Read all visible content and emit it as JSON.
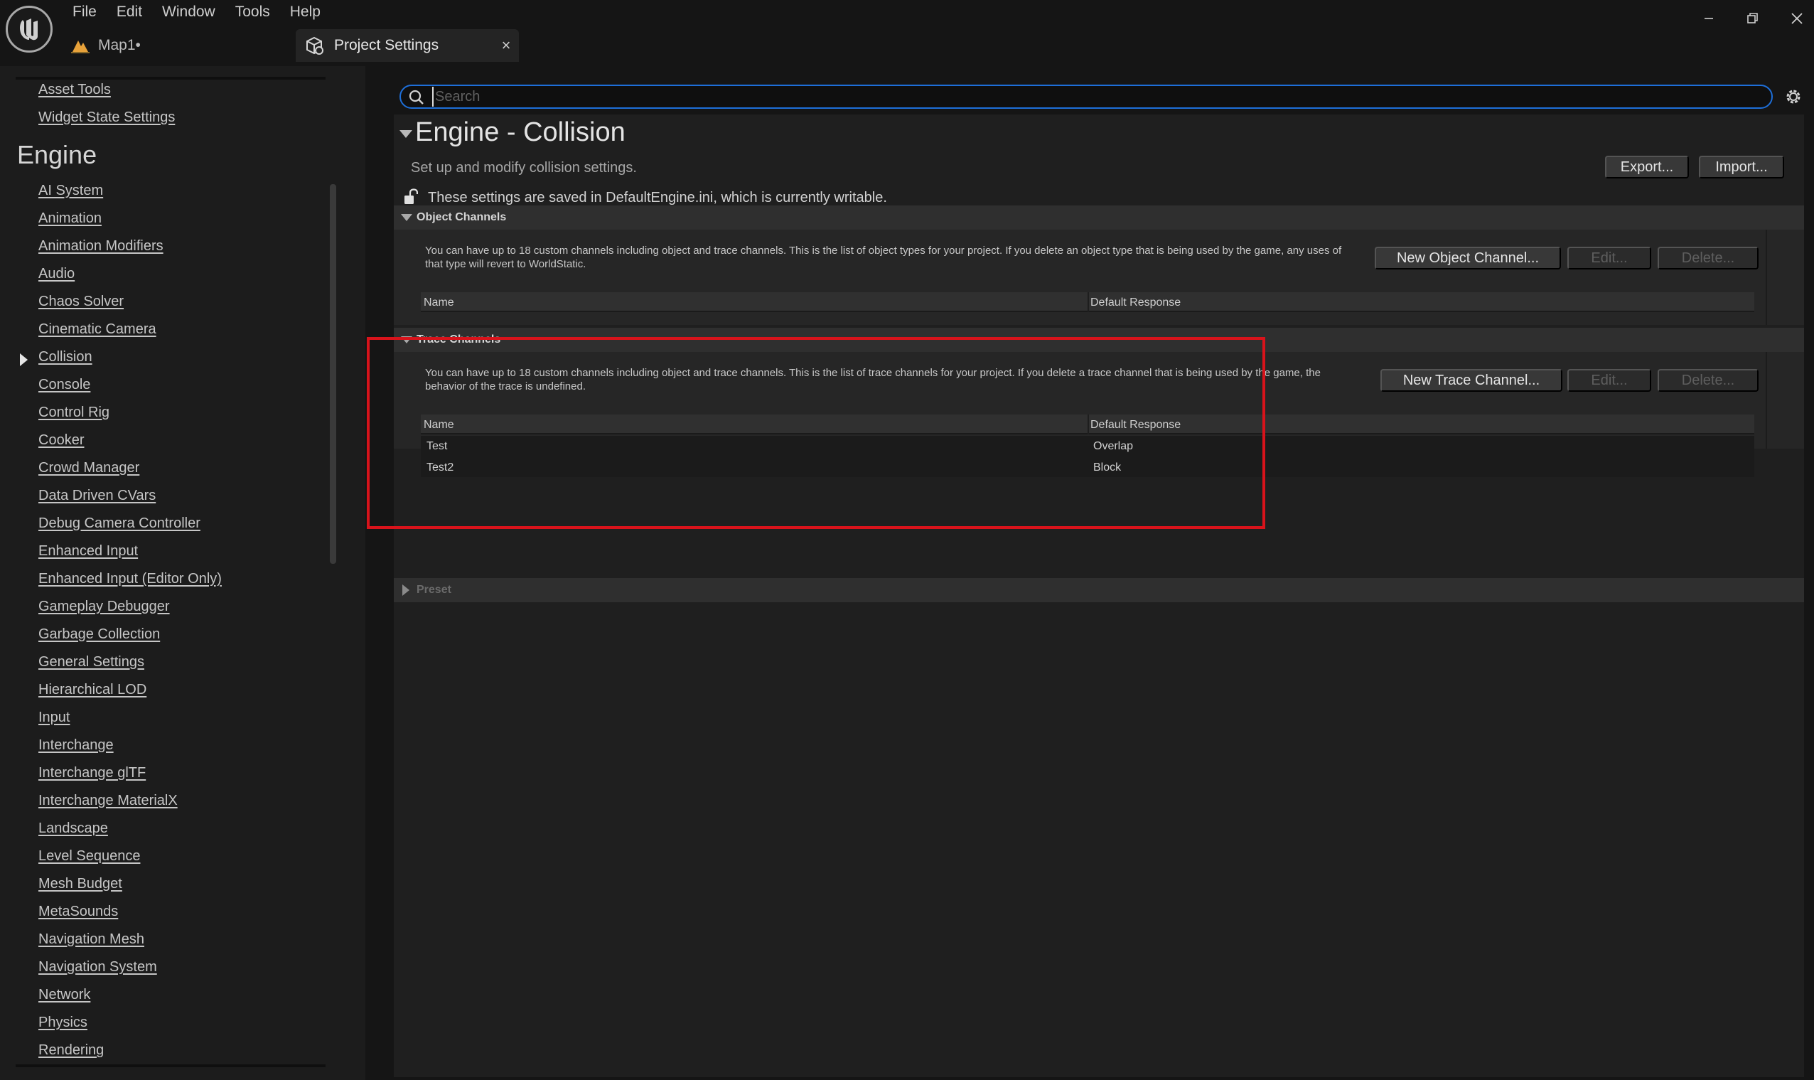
{
  "menu": [
    "File",
    "Edit",
    "Window",
    "Tools",
    "Help"
  ],
  "tabs": {
    "map": "Map1•",
    "settings": "Project Settings",
    "settings_close": "×"
  },
  "sidebar": {
    "top_items": [
      "Asset Tools",
      "Widget State Settings"
    ],
    "engine_heading": "Engine",
    "engine_items": [
      "AI System",
      "Animation",
      "Animation Modifiers",
      "Audio",
      "Chaos Solver",
      "Cinematic Camera",
      "Collision",
      "Console",
      "Control Rig",
      "Cooker",
      "Crowd Manager",
      "Data Driven CVars",
      "Debug Camera Controller",
      "Enhanced Input",
      "Enhanced Input (Editor Only)",
      "Gameplay Debugger",
      "Garbage Collection",
      "General Settings",
      "Hierarchical LOD",
      "Input",
      "Interchange",
      "Interchange glTF",
      "Interchange MaterialX",
      "Landscape",
      "Level Sequence",
      "Mesh Budget",
      "MetaSounds",
      "Navigation Mesh",
      "Navigation System",
      "Network",
      "Physics",
      "Rendering"
    ],
    "selected": "Collision"
  },
  "search": {
    "placeholder": "Search",
    "value": ""
  },
  "page": {
    "title": "Engine - Collision",
    "subtitle": "Set up and modify collision settings.",
    "export_label": "Export...",
    "import_label": "Import...",
    "writable_note": "These settings are saved in DefaultEngine.ini, which is currently writable."
  },
  "object_channels": {
    "title": "Object Channels",
    "description": "You can have up to 18 custom channels including object and trace channels. This is the list of object types for your project. If you delete an object type that is being used by the game, any uses of that type will revert to WorldStatic.",
    "new_label": "New Object Channel...",
    "edit_label": "Edit...",
    "delete_label": "Delete...",
    "columns": [
      "Name",
      "Default Response"
    ],
    "rows": []
  },
  "trace_channels": {
    "title": "Trace Channels",
    "description": "You can have up to 18 custom channels including object and trace channels. This is the list of trace channels for your project. If you delete a trace channel that is being used by the game, the behavior of the trace is undefined.",
    "new_label": "New Trace Channel...",
    "edit_label": "Edit...",
    "delete_label": "Delete...",
    "columns": [
      "Name",
      "Default Response"
    ],
    "rows": [
      {
        "name": "Test",
        "response": "Overlap"
      },
      {
        "name": "Test2",
        "response": "Block"
      }
    ]
  },
  "preset": {
    "title": "Preset"
  },
  "colors": {
    "accent_blue": "#1e6fd9",
    "highlight_red": "#d8131b",
    "ue_orange": "#e8a23a"
  },
  "icons": {
    "logo": "unreal-logo-icon",
    "search": "search-icon",
    "settings": "gear-icon",
    "lock": "unlocked-icon"
  }
}
